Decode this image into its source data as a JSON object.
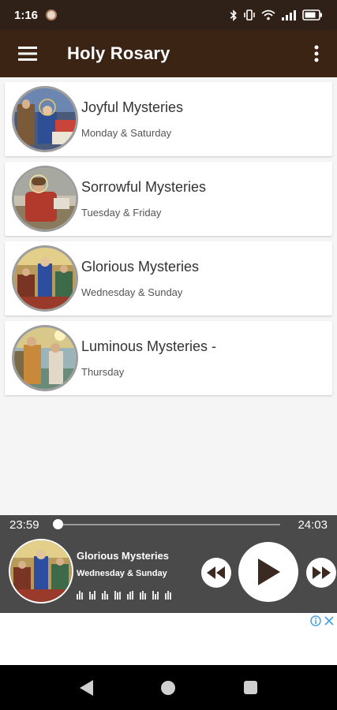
{
  "status_bar": {
    "time": "1:16"
  },
  "app_bar": {
    "title": "Holy Rosary"
  },
  "mysteries": [
    {
      "title": "Joyful Mysteries",
      "days": "Monday & Saturday",
      "icon": "nativity-painting"
    },
    {
      "title": "Sorrowful Mysteries",
      "days": "Tuesday & Friday",
      "icon": "gethsemane-painting"
    },
    {
      "title": "Glorious Mysteries",
      "days": "Wednesday & Sunday",
      "icon": "pentecost-painting"
    },
    {
      "title": "Luminous Mysteries -",
      "days": "Thursday",
      "icon": "baptism-painting"
    }
  ],
  "player": {
    "current_time": "23:59",
    "total_time": "24:03",
    "progress": 0.0,
    "title": "Glorious Mysteries",
    "subtitle": "Wednesday & Sunday"
  },
  "colors": {
    "status_bar": "#2f2118",
    "app_bar": "#3c2415",
    "player_bg": "#4a4a4a",
    "player_icon": "#3a2a22",
    "ad_choices": "#4aa3df"
  }
}
